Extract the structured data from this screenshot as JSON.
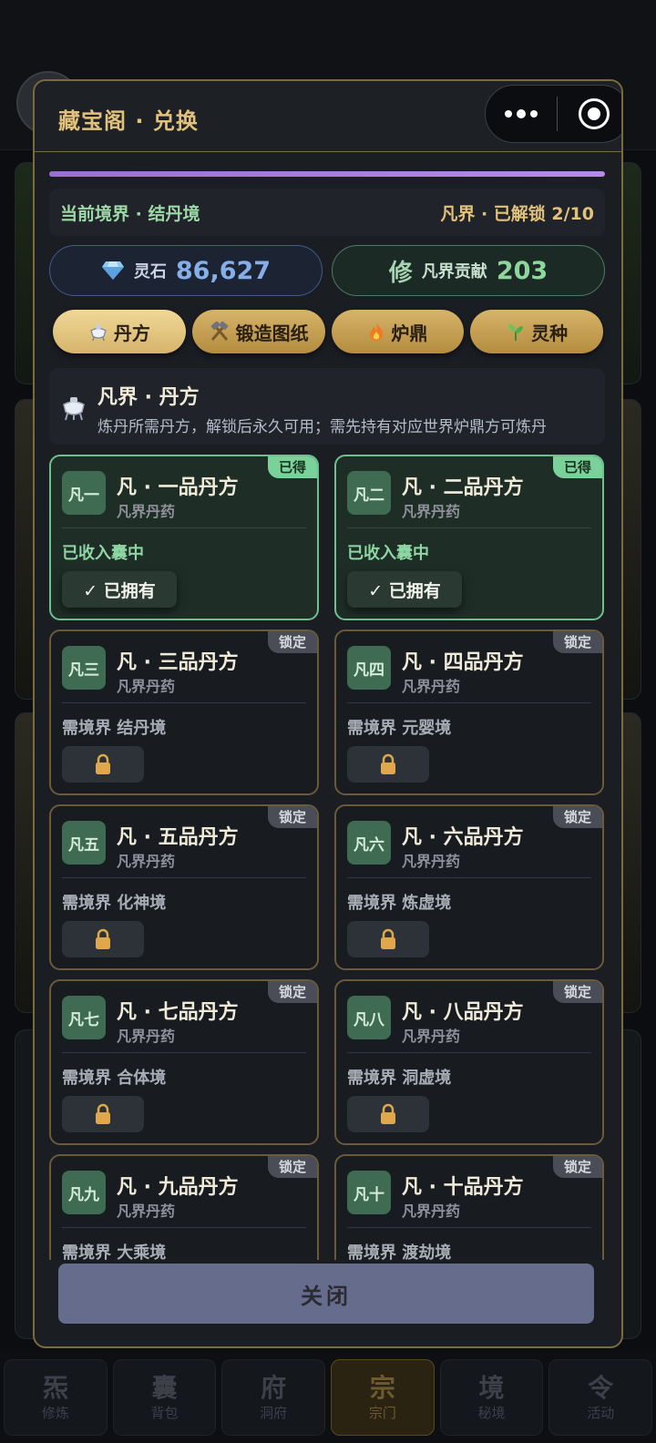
{
  "colors": {
    "accent_gold": "#e2c27a",
    "owned_border": "#6fbf8f",
    "locked_border": "#6b5a3a",
    "purple_bar": "#9b6fd0",
    "close_button": "#666d8c"
  },
  "modal": {
    "title": "藏宝阁 · 兑换",
    "realm": {
      "current": "当前境界 · 结丹境",
      "unlock": "凡界 · 已解锁 2/10"
    },
    "currency": {
      "stone": {
        "icon": "diamond-icon",
        "label": "灵石",
        "value": "86,627"
      },
      "contrib": {
        "icon_text": "修",
        "label": "凡界贡献",
        "value": "203"
      }
    },
    "tabs": [
      {
        "icon": "flask-icon",
        "label": "丹方",
        "active": true
      },
      {
        "icon": "hammer-icon",
        "label": "锻造图纸",
        "active": false
      },
      {
        "icon": "fire-icon",
        "label": "炉鼎",
        "active": false
      },
      {
        "icon": "sprout-icon",
        "label": "灵种",
        "active": false
      }
    ],
    "section": {
      "title": "凡界 · 丹方",
      "desc": "炼丹所需丹方，解锁后永久可用；需先持有对应世界炉鼎方可炼丹"
    },
    "items": [
      {
        "code": "凡一",
        "name": "凡 · 一品丹方",
        "sub": "凡界丹药",
        "badge": "已得",
        "req": "已收入囊中",
        "owned": true,
        "button": "✓ 已拥有"
      },
      {
        "code": "凡二",
        "name": "凡 · 二品丹方",
        "sub": "凡界丹药",
        "badge": "已得",
        "req": "已收入囊中",
        "owned": true,
        "button": "✓ 已拥有"
      },
      {
        "code": "凡三",
        "name": "凡 · 三品丹方",
        "sub": "凡界丹药",
        "badge": "锁定",
        "req": "需境界 结丹境",
        "owned": false
      },
      {
        "code": "凡四",
        "name": "凡 · 四品丹方",
        "sub": "凡界丹药",
        "badge": "锁定",
        "req": "需境界 元婴境",
        "owned": false
      },
      {
        "code": "凡五",
        "name": "凡 · 五品丹方",
        "sub": "凡界丹药",
        "badge": "锁定",
        "req": "需境界 化神境",
        "owned": false
      },
      {
        "code": "凡六",
        "name": "凡 · 六品丹方",
        "sub": "凡界丹药",
        "badge": "锁定",
        "req": "需境界 炼虚境",
        "owned": false
      },
      {
        "code": "凡七",
        "name": "凡 · 七品丹方",
        "sub": "凡界丹药",
        "badge": "锁定",
        "req": "需境界 合体境",
        "owned": false
      },
      {
        "code": "凡八",
        "name": "凡 · 八品丹方",
        "sub": "凡界丹药",
        "badge": "锁定",
        "req": "需境界 洞虚境",
        "owned": false
      },
      {
        "code": "凡九",
        "name": "凡 · 九品丹方",
        "sub": "凡界丹药",
        "badge": "锁定",
        "req": "需境界 大乘境",
        "owned": false
      },
      {
        "code": "凡十",
        "name": "凡 · 十品丹方",
        "sub": "凡界丹药",
        "badge": "锁定",
        "req": "需境界 渡劫境",
        "owned": false
      }
    ],
    "close_label": "关闭"
  },
  "bottom_nav": [
    {
      "glyph": "炁",
      "label": "修炼",
      "active": false
    },
    {
      "glyph": "囊",
      "label": "背包",
      "active": false
    },
    {
      "glyph": "府",
      "label": "洞府",
      "active": false
    },
    {
      "glyph": "宗",
      "label": "宗门",
      "active": true
    },
    {
      "glyph": "境",
      "label": "秘境",
      "active": false
    },
    {
      "glyph": "令",
      "label": "活动",
      "active": false
    }
  ]
}
